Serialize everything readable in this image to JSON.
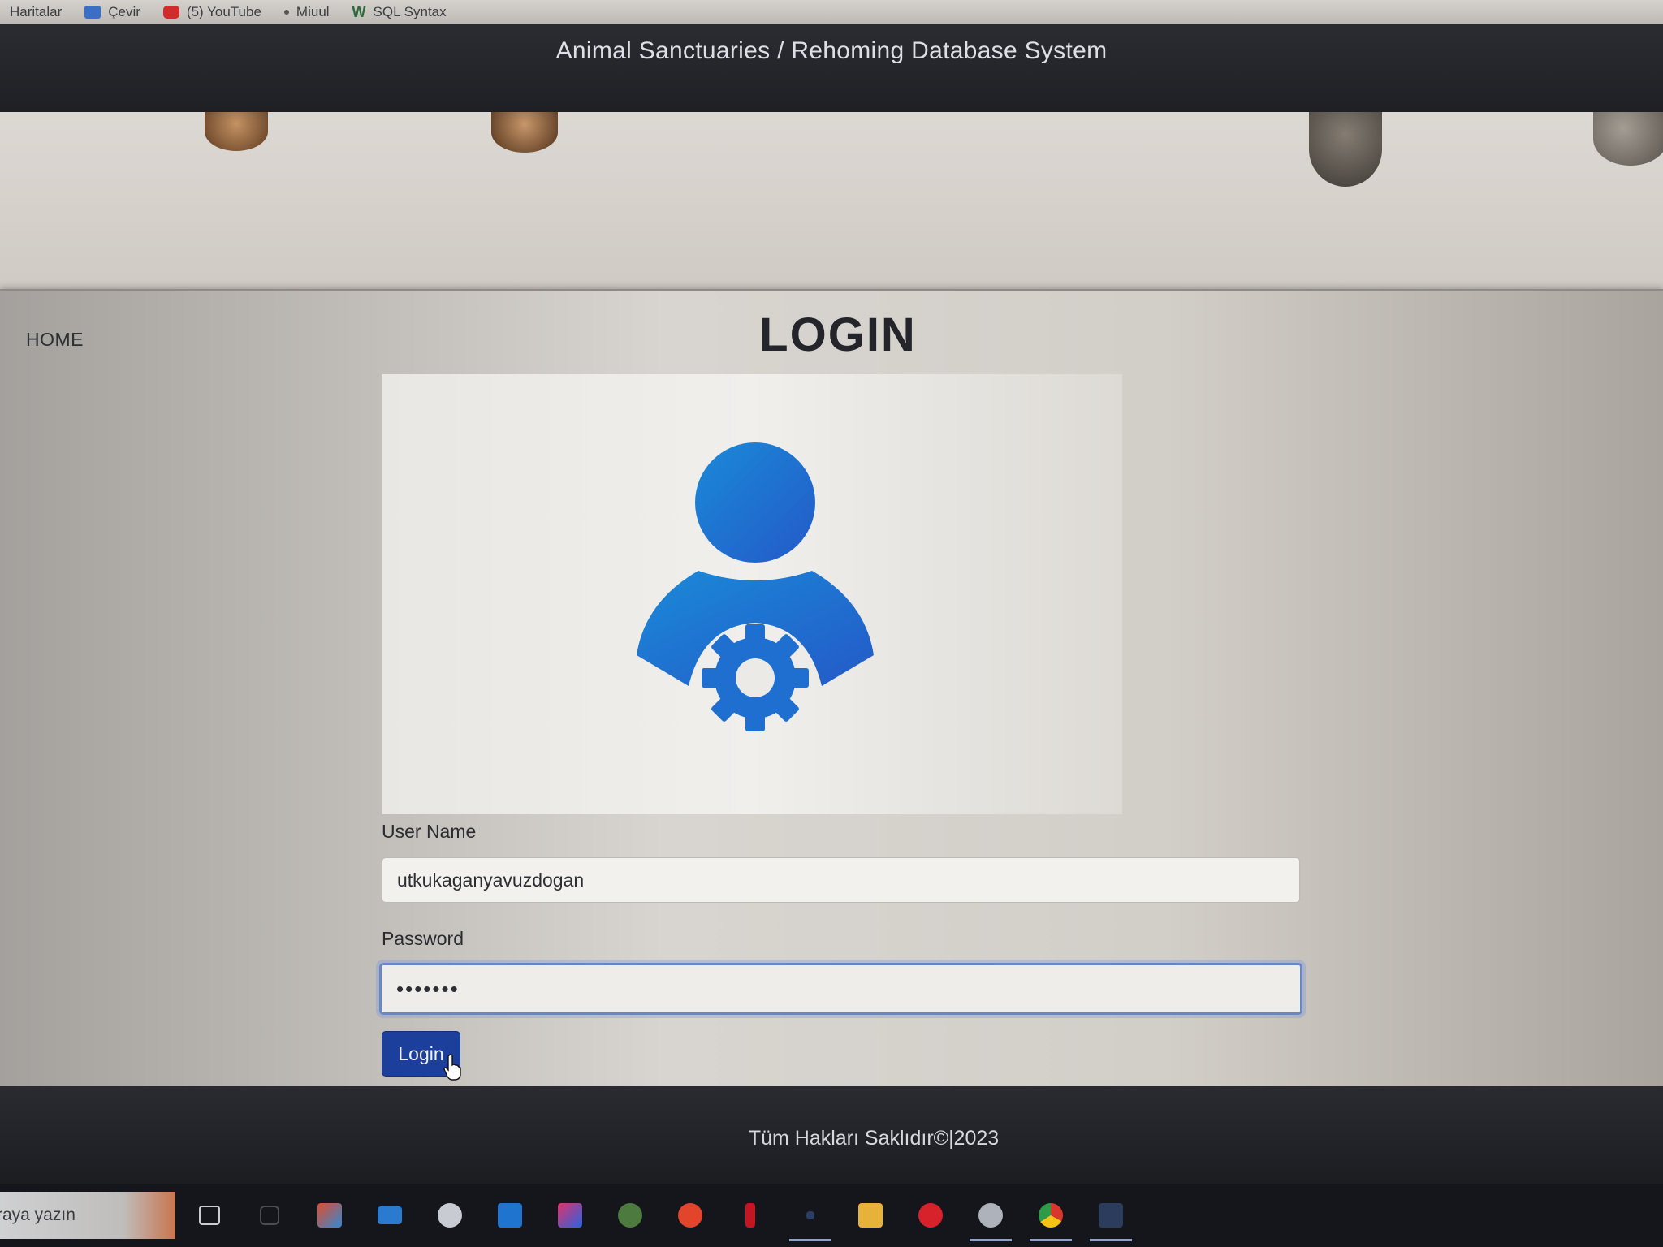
{
  "bookmarks": [
    {
      "label": "Haritalar",
      "icon": "map-icon"
    },
    {
      "label": "Çevir",
      "icon": "translate-icon"
    },
    {
      "label": "(5) YouTube",
      "icon": "youtube-icon"
    },
    {
      "label": "Miuul",
      "icon": "miuul-icon"
    },
    {
      "label": "SQL Syntax",
      "icon": "w3schools-icon"
    }
  ],
  "header": {
    "title": "Animal Sanctuaries / Rehoming Database System"
  },
  "nav": {
    "home_label": "HOME"
  },
  "login": {
    "title": "LOGIN",
    "username_label": "User Name",
    "username_value": "utkukaganyavuzdogan",
    "password_label": "Password",
    "password_value": "•••••••",
    "button_label": "Login"
  },
  "footer": {
    "text": "Tüm Hakları Saklıdır©|2023"
  },
  "taskbar": {
    "search_text": "raya yazın",
    "apps": [
      "task-view-icon",
      "cortana-icon",
      "store-icon",
      "mail-icon",
      "steam-icon",
      "vscode-icon",
      "intellij-icon",
      "shield-app-icon",
      "terminal-icon",
      "netflix-icon",
      "app-icon",
      "file-explorer-icon",
      "opera-icon",
      "settings-icon",
      "chrome-icon",
      "mysql-workbench-icon"
    ]
  },
  "colors": {
    "header_bg": "#1f2024",
    "accent_button": "#1b3f9a",
    "avatar_blue": "#1f6fd6",
    "focus_border": "#6b86c8"
  }
}
